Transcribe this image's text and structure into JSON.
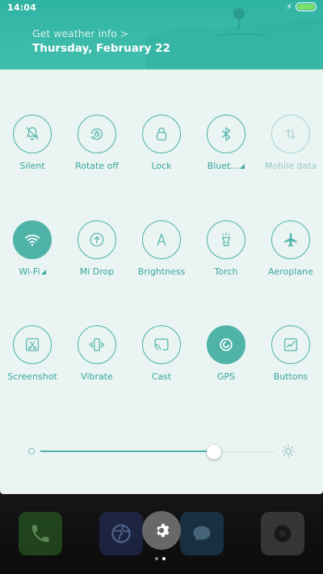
{
  "status": {
    "time": "14:04"
  },
  "header": {
    "weather_link": "Get weather info >",
    "date": "Thursday, February 22"
  },
  "tiles": [
    {
      "id": "silent",
      "label": "Silent",
      "icon": "bell-off-icon",
      "state": "off"
    },
    {
      "id": "rotate-off",
      "label": "Rotate off",
      "icon": "rotate-lock-icon",
      "state": "off"
    },
    {
      "id": "lock",
      "label": "Lock",
      "icon": "lock-icon",
      "state": "off"
    },
    {
      "id": "bluetooth",
      "label": "Bluet…",
      "icon": "bluetooth-icon",
      "state": "off",
      "more": true
    },
    {
      "id": "mobile-data",
      "label": "Mobile data",
      "icon": "mobile-data-icon",
      "state": "disabled"
    },
    {
      "id": "wifi",
      "label": "Wi-Fi",
      "icon": "wifi-icon",
      "state": "on",
      "more": true
    },
    {
      "id": "mi-drop",
      "label": "Mi Drop",
      "icon": "mi-drop-icon",
      "state": "off"
    },
    {
      "id": "brightness",
      "label": "Brightness",
      "icon": "auto-brightness-icon",
      "state": "off"
    },
    {
      "id": "torch",
      "label": "Torch",
      "icon": "torch-icon",
      "state": "off"
    },
    {
      "id": "aeroplane",
      "label": "Aeroplane",
      "icon": "airplane-icon",
      "state": "off"
    },
    {
      "id": "screenshot",
      "label": "Screenshot",
      "icon": "screenshot-icon",
      "state": "off"
    },
    {
      "id": "vibrate",
      "label": "Vibrate",
      "icon": "vibrate-icon",
      "state": "off"
    },
    {
      "id": "cast",
      "label": "Cast",
      "icon": "cast-icon",
      "state": "off"
    },
    {
      "id": "gps",
      "label": "GPS",
      "icon": "gps-icon",
      "state": "on"
    },
    {
      "id": "buttons",
      "label": "Buttons",
      "icon": "buttons-icon",
      "state": "off"
    }
  ],
  "brightness_level": 0.74,
  "dock": {
    "apps": [
      "phone-icon",
      "browser-icon",
      "messages-icon",
      "camera-icon"
    ],
    "page_count": 2,
    "active_page": 1
  },
  "colors": {
    "accent": "#4fb3a8",
    "header": "#36b6a6",
    "panel": "#e9f4f3"
  }
}
